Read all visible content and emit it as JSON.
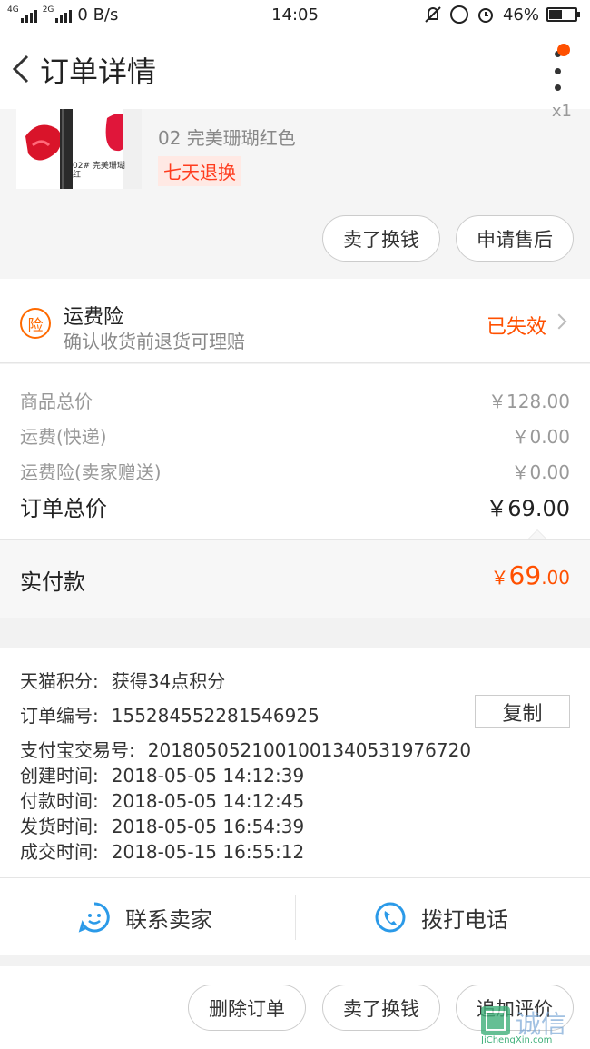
{
  "status_bar": {
    "net_speed": "0 B/s",
    "time": "14:05",
    "battery": "46%",
    "battery_level": 0.46,
    "sim1": "4G",
    "sim2": "2G"
  },
  "header": {
    "title": "订单详情"
  },
  "product": {
    "thumb_text": "02# 完美珊瑚红",
    "variant": "02 完美珊瑚红色",
    "tag": "七天退换",
    "qty": "x1",
    "buttons": [
      "卖了换钱",
      "申请售后"
    ]
  },
  "insurance": {
    "badge": "险",
    "title": "运费险",
    "subtitle": "确认收货前退货可理赔",
    "status": "已失效"
  },
  "prices": {
    "rows": [
      {
        "label": "商品总价",
        "value": "￥128.00"
      },
      {
        "label": "运费(快递)",
        "value": "￥0.00"
      },
      {
        "label": "运费险(卖家赠送)",
        "value": "￥0.00"
      }
    ],
    "total_label": "订单总价",
    "total_value": "￥69.00"
  },
  "paid": {
    "label": "实付款",
    "currency": "￥",
    "integer": "69",
    "decimal": ".00"
  },
  "info": {
    "rows": [
      {
        "label": "天猫积分:",
        "value": "获得34点积分"
      },
      {
        "label": "订单编号:",
        "value": "1552845522815469​25"
      },
      {
        "label": "支付宝交易号:",
        "value": "2018050521001001340531976720"
      },
      {
        "label": "创建时间:",
        "value": "2018-05-05 14:12:39"
      },
      {
        "label": "付款时间:",
        "value": "2018-05-05 14:12:45"
      },
      {
        "label": "发货时间:",
        "value": "2018-05-05 16:54:39"
      },
      {
        "label": "成交时间:",
        "value": "2018-05-15 16:55:12"
      }
    ],
    "copy_label": "复制"
  },
  "contact": {
    "seller": "联系卖家",
    "phone": "拨打电话"
  },
  "bottom_bar": {
    "buttons": [
      "删除订单",
      "卖了换钱",
      "追加评价"
    ]
  },
  "watermark": {
    "text": "诚信",
    "url_text": "JiChengXin.com"
  },
  "colors": {
    "accent": "#ff5000",
    "icon_blue": "#2b9ae8",
    "text": "#333333"
  }
}
